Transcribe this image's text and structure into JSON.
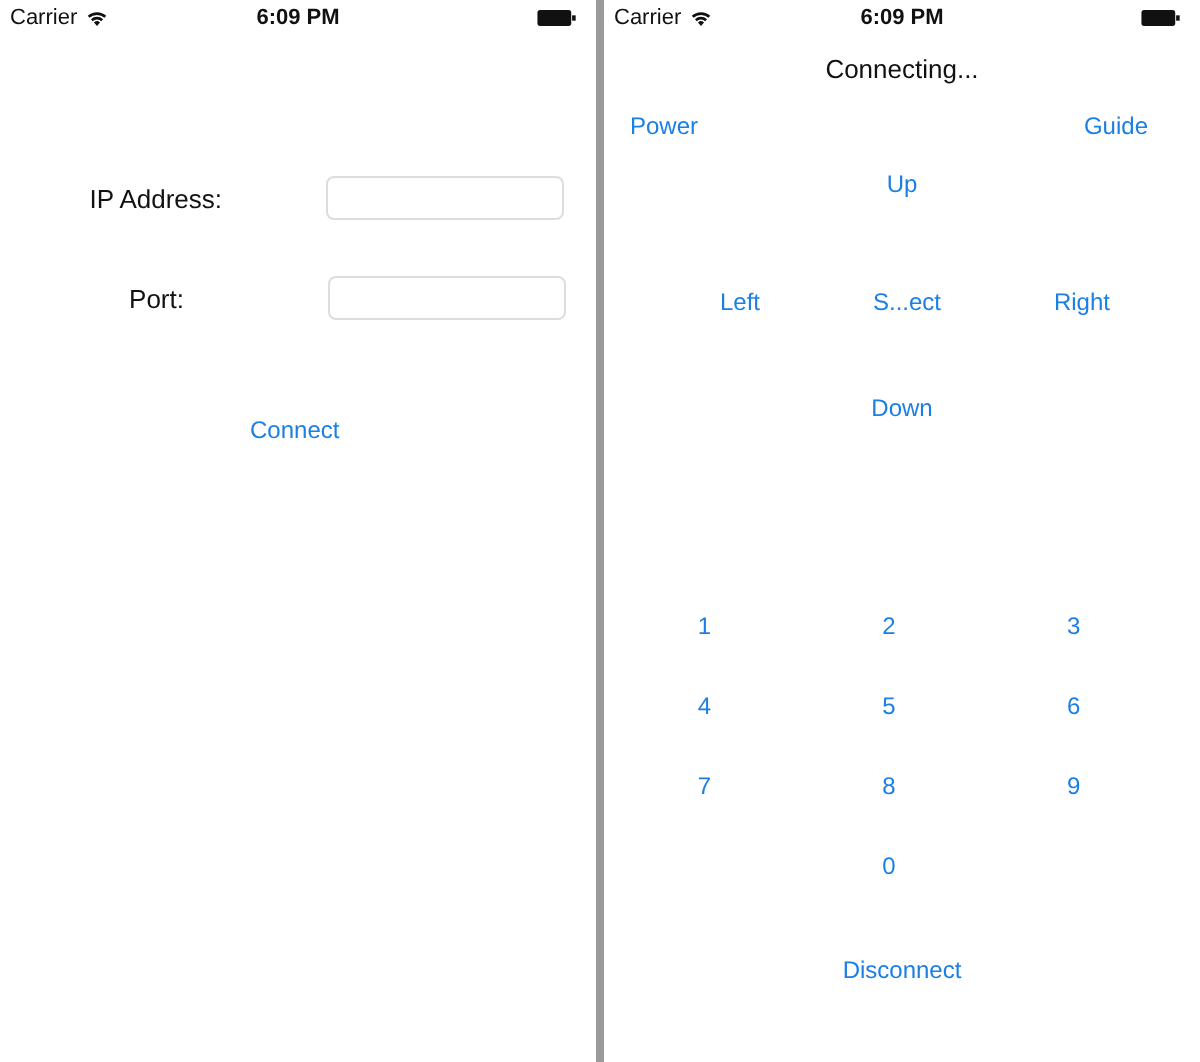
{
  "login_screen": {
    "status_bar": {
      "carrier": "Carrier",
      "time": "6:09 PM"
    },
    "fields": [
      {
        "label": "IP Address:"
      },
      {
        "label": "Port:"
      }
    ],
    "connect_button": "Connect"
  },
  "remote_screen": {
    "status_bar": {
      "carrier": "Carrier",
      "time": "6:09 PM"
    },
    "title": "Connecting...",
    "top_buttons": [
      "Power",
      "Guide"
    ],
    "up_button": "Up",
    "middle_buttons": [
      "Left",
      "S...ect",
      "Right"
    ],
    "down_button": "Down",
    "number_rows": [
      [
        "1",
        "2",
        "3"
      ],
      [
        "4",
        "5",
        "6"
      ],
      [
        "7",
        "8",
        "9"
      ],
      [
        "",
        "0",
        ""
      ]
    ],
    "disconnect_button": "Disconnect"
  }
}
